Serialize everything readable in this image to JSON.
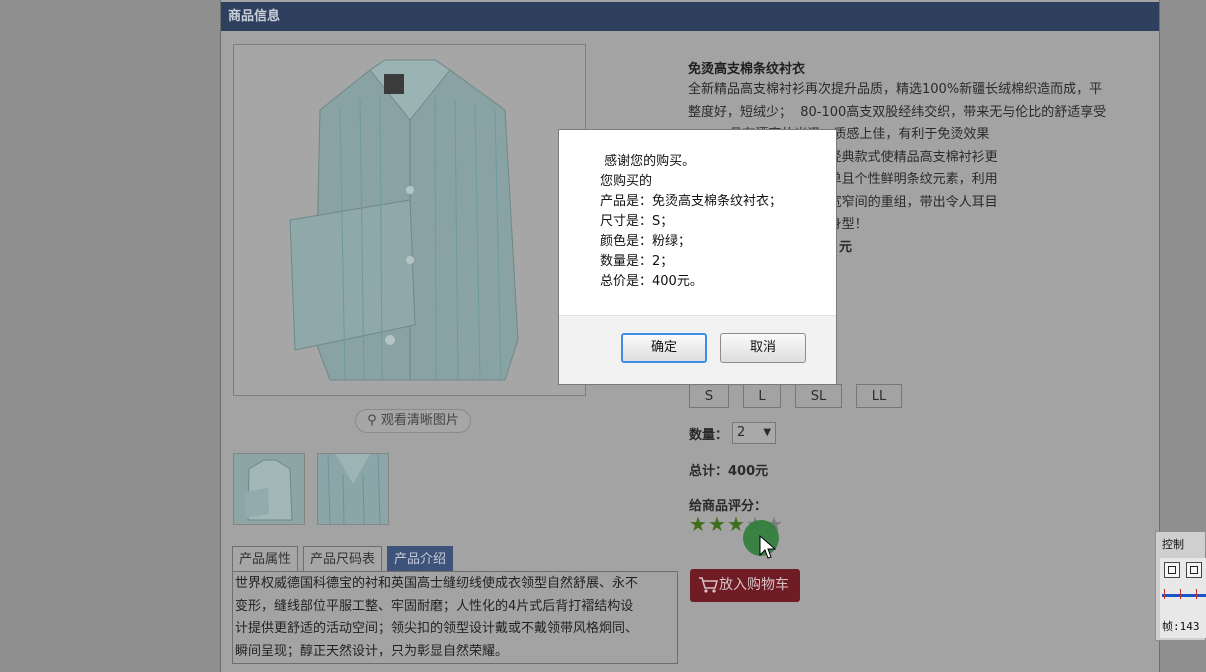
{
  "panel": {
    "title": "商品信息"
  },
  "gallery": {
    "zoom_label": "观看清晰图片"
  },
  "tabs": [
    {
      "label": "产品属性"
    },
    {
      "label": "产品尺码表"
    },
    {
      "label": "产品介绍"
    }
  ],
  "tab_content": [
    "世界权威德国科德宝的衬和英国高士缝纫线使成衣领型自然舒展、永不",
    "变形，缝线部位平服工整、牢固耐磨；人性化的4片式后背打褶结构设",
    "计提供更舒适的活动空间；领尖扣的领型设计戴或不戴领带风格炯同、",
    "瞬间呈现；醇正天然设计，只为彰显自然荣耀。"
  ],
  "product": {
    "title": "免烫高支棉条纹衬衣",
    "description_lines": [
      "全新精品高支棉衬衫再次提升品质，精选100%新疆长绒棉织造而成，平",
      "整度好，短绒少；  80-100高支双股经纬交织，带来无与伦比的舒适享受",
      "          具有漂亮的光泽，质感上佳，有利于免烫效果",
      "            受消费者欢迎的经典款式使精品高支棉衬衫更",
      "            款衬衫还采用简单且个性鲜明条纹元素，利用",
      "            过条纹的粗细、宽窄间的重组，带出令人耳目",
      "            俊朗男士的挺拔身型！"
    ],
    "price_fragment": "元"
  },
  "sizes": [
    "S",
    "L",
    "SL",
    "LL"
  ],
  "quantity": {
    "label": "数量：",
    "value": "2"
  },
  "total": {
    "text": "总计：400元"
  },
  "rating": {
    "label": "给商品评分：",
    "filled": 3,
    "max": 5
  },
  "cart_button": {
    "label": "放入购物车"
  },
  "dialog": {
    "lines": [
      " 感谢您的购买。",
      "您购买的",
      "产品是：免烫高支棉条纹衬衣；",
      "尺寸是：S；",
      "颜色是：粉绿；",
      "数量是：2；",
      "总价是：400元。"
    ],
    "ok_label": "确定",
    "cancel_label": "取消"
  },
  "control_window": {
    "title": "控制",
    "frame_label": "帧:143"
  }
}
